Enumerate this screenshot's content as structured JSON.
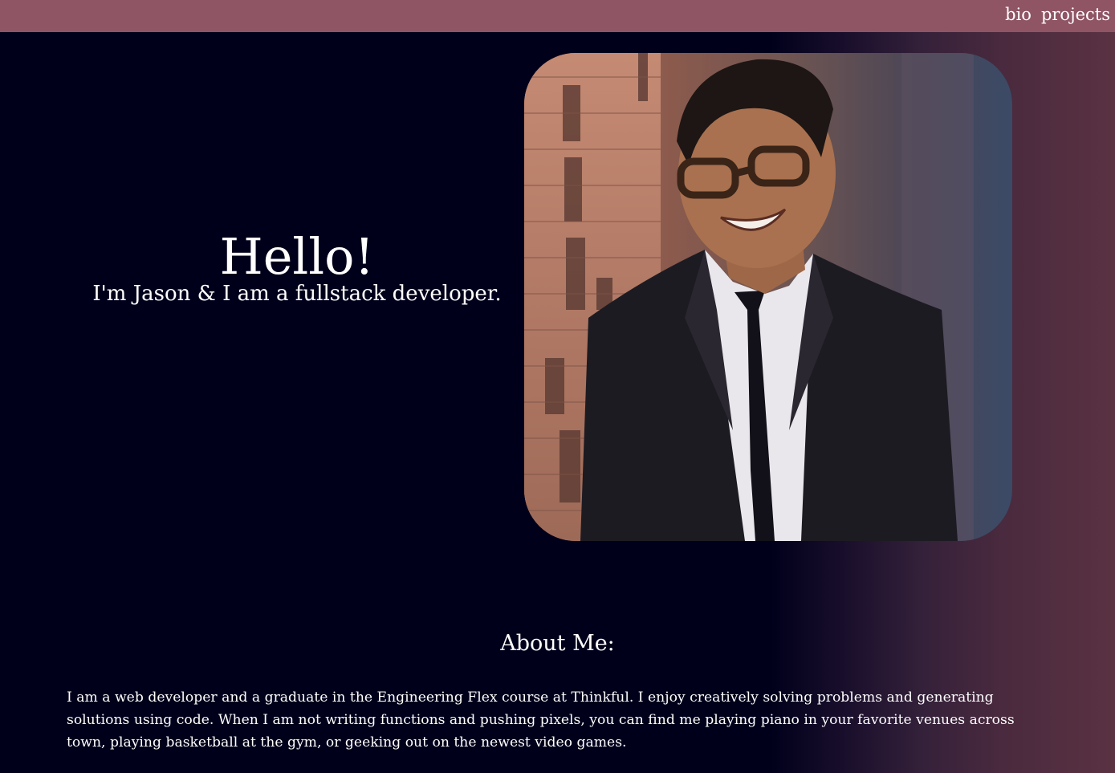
{
  "nav": {
    "items": [
      {
        "label": "bio"
      },
      {
        "label": "projects"
      }
    ]
  },
  "hero": {
    "title": "Hello!",
    "subtitle": "I'm Jason & I am a fullstack developer."
  },
  "about": {
    "heading": "About Me:",
    "body": "I am a web developer and a graduate in the Engineering Flex course at Thinkful. I enjoy creatively solving problems and generating solutions using code. When I am not writing functions and pushing pixels, you can find me playing piano in your favorite venues across town, playing basketball at the gym, or geeking out on the newest video games."
  },
  "colors": {
    "topbar": "#8f5565",
    "background": "#00001b",
    "background_right": "#5a3242",
    "text": "#ffffff"
  }
}
